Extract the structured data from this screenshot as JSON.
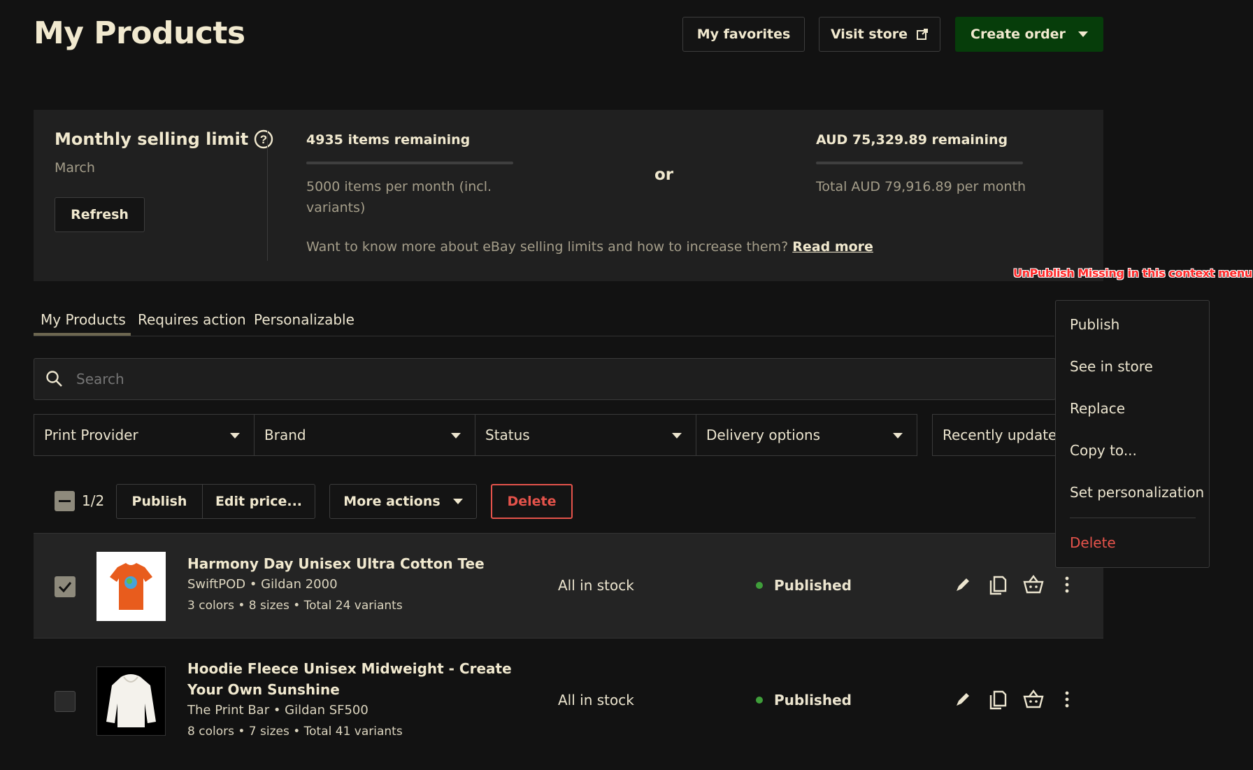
{
  "header": {
    "title": "My Products",
    "favorites_label": "My favorites",
    "visit_store_label": "Visit store",
    "create_order_label": "Create order"
  },
  "limit": {
    "title": "Monthly selling limit",
    "month": "March",
    "refresh_label": "Refresh",
    "items_remaining": "4935 items remaining",
    "items_detail": "5000 items per month (incl. variants)",
    "or_label": "or",
    "aud_remaining": "AUD 75,329.89 remaining",
    "aud_detail": "Total AUD 79,916.89 per month",
    "info_text": "Want to know more about eBay selling limits and how to increase them?",
    "read_more": "Read more"
  },
  "annotation": "UnPublish Missing in this context menu",
  "tabs": [
    {
      "label": "My Products",
      "active": true
    },
    {
      "label": "Requires action",
      "active": false
    },
    {
      "label": "Personalizable",
      "active": false
    }
  ],
  "search": {
    "placeholder": "Search"
  },
  "filters": {
    "print_provider": "Print Provider",
    "brand": "Brand",
    "status": "Status",
    "delivery": "Delivery options",
    "sort": "Recently updated"
  },
  "bulk": {
    "selected_count": "1/2",
    "publish": "Publish",
    "edit_price": "Edit price...",
    "more_actions": "More actions",
    "delete": "Delete"
  },
  "products": [
    {
      "title": "Harmony Day Unisex Ultra Cotton Tee",
      "provider": "SwiftPOD • Gildan 2000",
      "variants": "3 colors • 8 sizes • Total 24 variants",
      "stock": "All in stock",
      "status": "Published",
      "checked": true
    },
    {
      "title": "Hoodie Fleece Unisex Midweight - Create Your Own Sunshine",
      "provider": "The Print Bar • Gildan SF500",
      "variants": "8 colors • 7 sizes • Total 41 variants",
      "stock": "All in stock",
      "status": "Published",
      "checked": false
    }
  ],
  "context_menu": {
    "items": [
      "Publish",
      "See in store",
      "Replace",
      "Copy to...",
      "Set personalization"
    ],
    "delete": "Delete"
  },
  "colors": {
    "background": "#121212",
    "panel": "#202020",
    "brand_green": "#063d0a",
    "danger": "#e5534b",
    "status_green": "#3f9e3a",
    "annotation_red": "#ff2a2a"
  }
}
